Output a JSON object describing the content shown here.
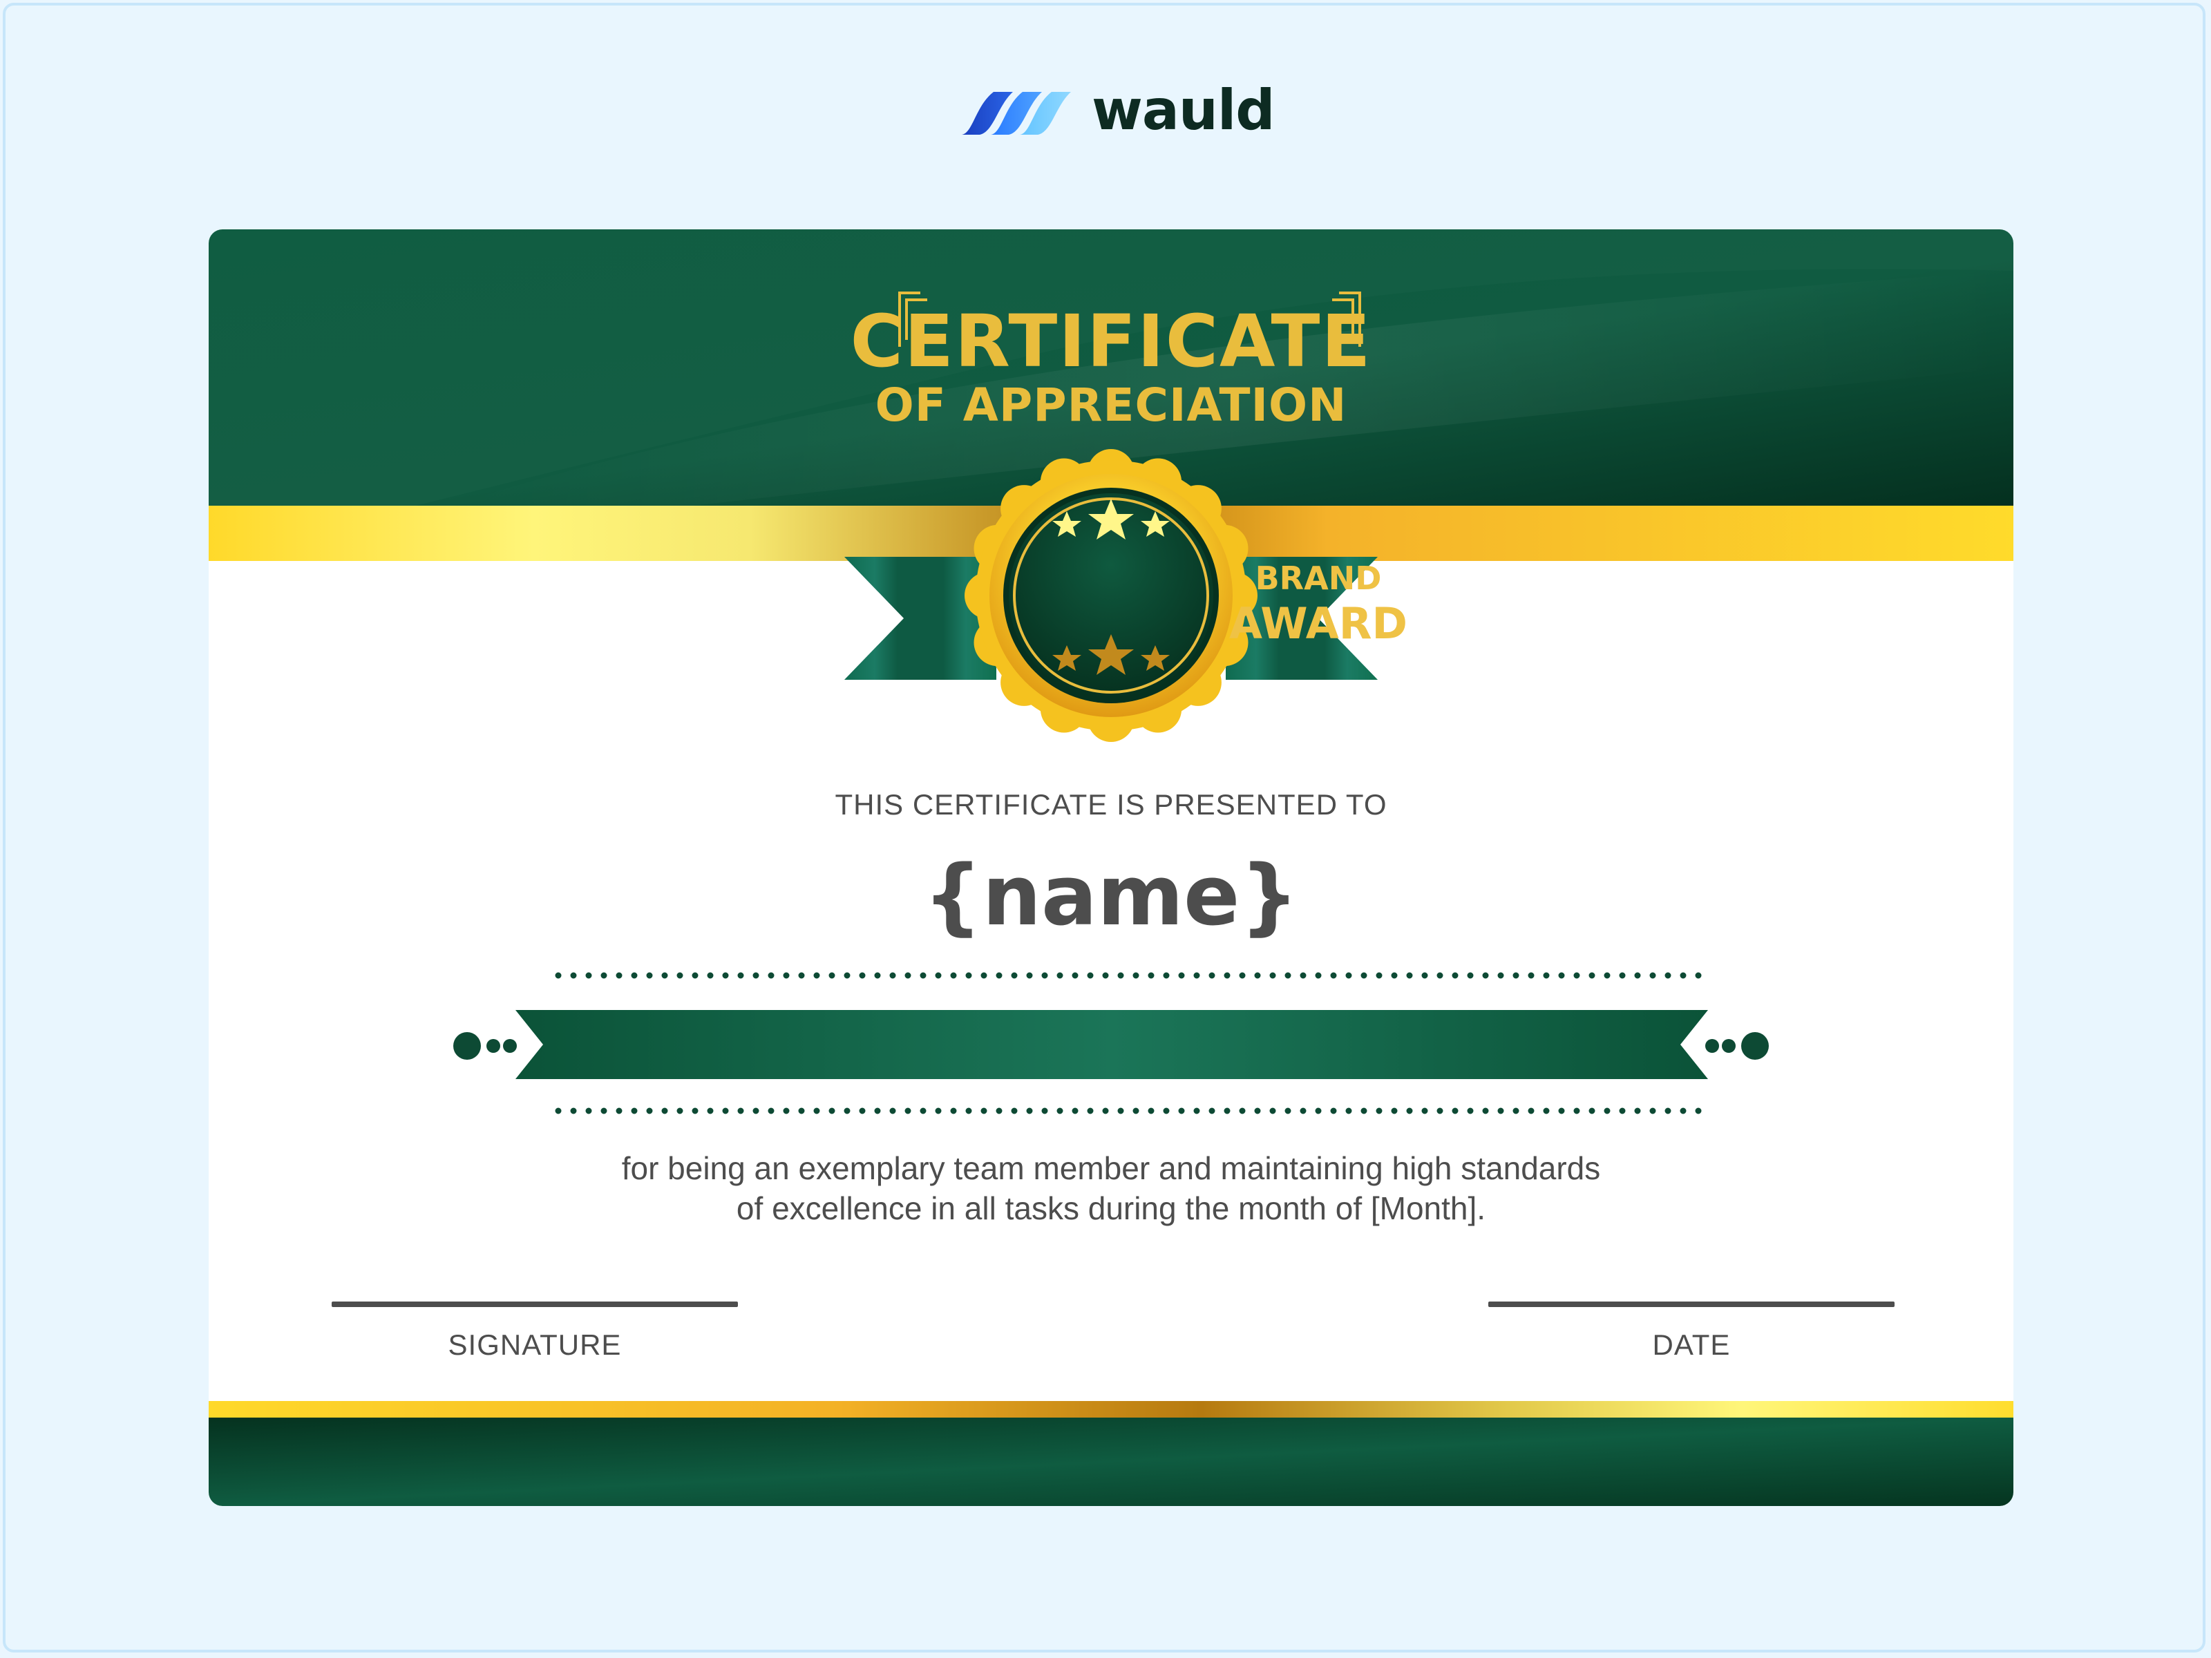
{
  "brand": {
    "logo_text": "wauld",
    "logo_icon": "wauld-wave-icon"
  },
  "certificate": {
    "title": "CERTIFICATE",
    "subtitle": "OF APPRECIATION",
    "badge": {
      "line1": "BRAND",
      "line2": "AWARD",
      "icon": "award-seal-icon"
    },
    "presented_to_label": "THIS CERTIFICATE IS PRESENTED TO",
    "recipient_name": "{name}",
    "description_line1": "for being an exemplary team member and maintaining high standards",
    "description_line2": "of excellence in all tasks during the month of [Month].",
    "signature_label": "SIGNATURE",
    "date_label": "DATE"
  },
  "colors": {
    "page_background": "#e9f6fe",
    "dark_green": "#0d4a34",
    "teal_green": "#1b7356",
    "gold": "#e9bd3d",
    "yellow": "#ffdb2e",
    "text_gray": "#4d4d4d"
  }
}
